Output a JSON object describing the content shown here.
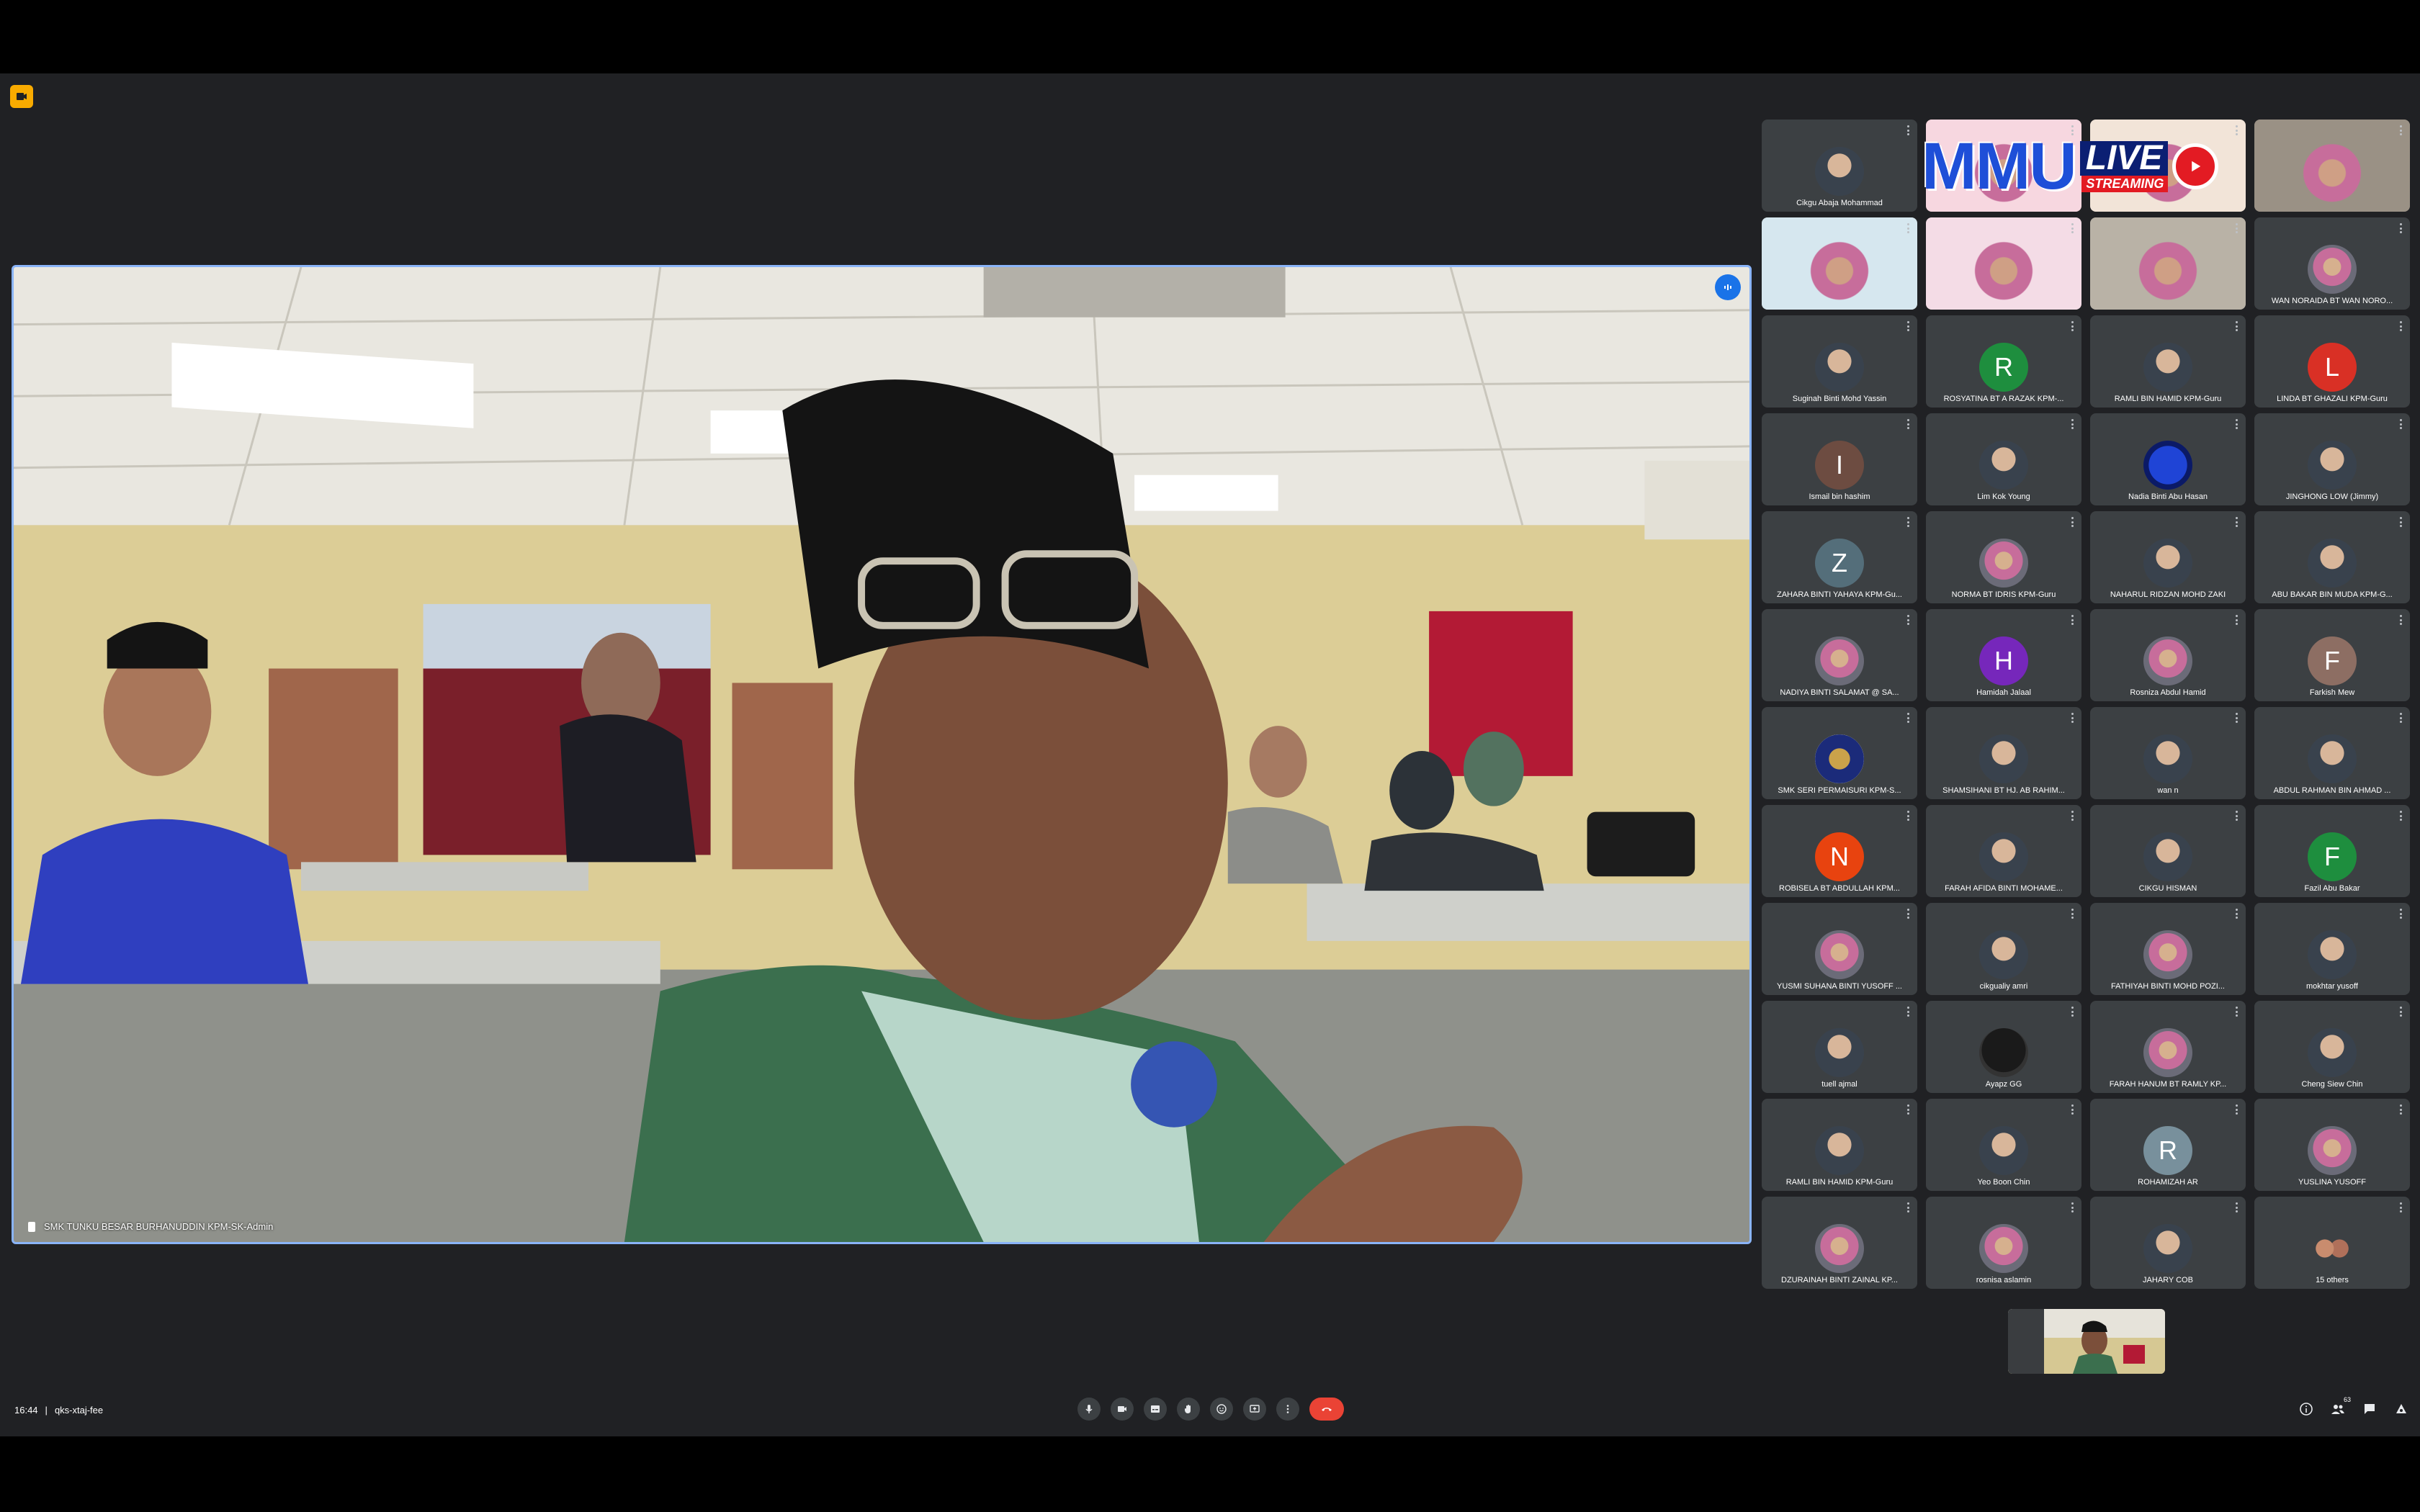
{
  "meeting": {
    "time": "16:44",
    "separator": "|",
    "code": "qks-xtaj-fee"
  },
  "main_speaker": {
    "name": "SMK TUNKU BESAR BURHANUDDIN KPM-SK-Admin"
  },
  "live_banner": {
    "brand": "MMU",
    "live": "LIVE",
    "streaming": "STREAMING"
  },
  "participants": [
    {
      "name": "Cikgu Abaja Mohammad",
      "avatar": "photo"
    },
    {
      "name": "",
      "avatar": "video"
    },
    {
      "name": "",
      "avatar": "video"
    },
    {
      "name": "",
      "avatar": "video"
    },
    {
      "name": "",
      "avatar": "video"
    },
    {
      "name": "",
      "avatar": "video"
    },
    {
      "name": "",
      "avatar": "video"
    },
    {
      "name": "WAN NORAIDA BT WAN NORO...",
      "avatar": "photo-hijab"
    },
    {
      "name": "Suginah Binti Mohd Yassin",
      "avatar": "photo"
    },
    {
      "name": "ROSYATINA BT A RAZAK KPM-...",
      "initial": "R",
      "color": "#1e8e3e"
    },
    {
      "name": "RAMLI BIN HAMID KPM-Guru",
      "avatar": "photo"
    },
    {
      "name": "LINDA BT GHAZALI KPM-Guru",
      "initial": "L",
      "color": "#d93025"
    },
    {
      "name": "Ismail bin hashim",
      "initial": "I",
      "color": "#6d4c41"
    },
    {
      "name": "Lim Kok Young",
      "avatar": "photo"
    },
    {
      "name": "Nadia Binti Abu Hasan",
      "avatar": "photo-blue"
    },
    {
      "name": "JINGHONG LOW (Jimmy)",
      "avatar": "photo"
    },
    {
      "name": "ZAHARA BINTI YAHAYA KPM-Gu...",
      "initial": "Z",
      "color": "#546e7a"
    },
    {
      "name": "NORMA BT IDRIS KPM-Guru",
      "avatar": "photo-hijab"
    },
    {
      "name": "NAHARUL RIDZAN MOHD ZAKI",
      "avatar": "photo"
    },
    {
      "name": "ABU BAKAR BIN MUDA KPM-G...",
      "avatar": "photo"
    },
    {
      "name": "NADIYA BINTI SALAMAT @ SA...",
      "avatar": "photo-hijab"
    },
    {
      "name": "Hamidah Jalaal",
      "initial": "H",
      "color": "#7627bb"
    },
    {
      "name": "Rosniza Abdul Hamid",
      "avatar": "photo-hijab"
    },
    {
      "name": "Farkish Mew",
      "initial": "F",
      "color": "#8d6e63"
    },
    {
      "name": "SMK SERI PERMAISURI KPM-S...",
      "avatar": "photo-badge"
    },
    {
      "name": "SHAMSIHANI BT HJ. AB RAHIM...",
      "avatar": "photo"
    },
    {
      "name": "wan n",
      "avatar": "photo"
    },
    {
      "name": "ABDUL RAHMAN BIN AHMAD ...",
      "avatar": "photo"
    },
    {
      "name": "ROBISELA BT ABDULLAH KPM...",
      "initial": "N",
      "color": "#e8430f"
    },
    {
      "name": "FARAH AFIDA BINTI MOHAME...",
      "avatar": "photo"
    },
    {
      "name": "CIKGU HISMAN",
      "avatar": "photo"
    },
    {
      "name": "Fazil Abu Bakar",
      "initial": "F",
      "color": "#1e8e3e"
    },
    {
      "name": "YUSMI SUHANA BINTI YUSOFF ...",
      "avatar": "photo-hijab"
    },
    {
      "name": "cikgualiy amri",
      "avatar": "photo"
    },
    {
      "name": "FATHIYAH BINTI MOHD POZI...",
      "avatar": "photo-hijab"
    },
    {
      "name": "mokhtar yusoff",
      "avatar": "photo"
    },
    {
      "name": "tuell ajmal",
      "avatar": "photo"
    },
    {
      "name": "Ayapz GG",
      "avatar": "photo-dark"
    },
    {
      "name": "FARAH HANUM BT RAMLY KP...",
      "avatar": "photo-hijab"
    },
    {
      "name": "Cheng Siew Chin",
      "avatar": "photo"
    },
    {
      "name": "RAMLI BIN HAMID KPM-Guru",
      "avatar": "photo"
    },
    {
      "name": "Yeo Boon Chin",
      "avatar": "photo"
    },
    {
      "name": "ROHAMIZAH AR",
      "initial": "R",
      "color": "#78909c"
    },
    {
      "name": "YUSLINA YUSOFF",
      "avatar": "photo-hijab"
    },
    {
      "name": "DZURAINAH BINTI ZAINAL KP...",
      "avatar": "photo-hijab"
    },
    {
      "name": "rosnisa aslamin",
      "avatar": "photo-hijab"
    },
    {
      "name": "JAHARY COB",
      "avatar": "photo"
    },
    {
      "name": "15 others",
      "avatar": "group"
    }
  ],
  "colors": {
    "background": "#202124",
    "tile": "#3c4043",
    "active_speaker_border": "#8ab4f8",
    "end_call": "#ea4335"
  },
  "controls": [
    {
      "icon": "microphone-icon"
    },
    {
      "icon": "camera-icon"
    },
    {
      "icon": "captions-icon"
    },
    {
      "icon": "raise-hand-icon"
    },
    {
      "icon": "emoji-icon"
    },
    {
      "icon": "present-screen-icon"
    },
    {
      "icon": "more-options-icon"
    },
    {
      "icon": "end-call-icon"
    }
  ],
  "right_controls": [
    {
      "icon": "info-icon"
    },
    {
      "icon": "people-icon",
      "badge": "63"
    },
    {
      "icon": "chat-icon"
    },
    {
      "icon": "activities-icon"
    }
  ]
}
